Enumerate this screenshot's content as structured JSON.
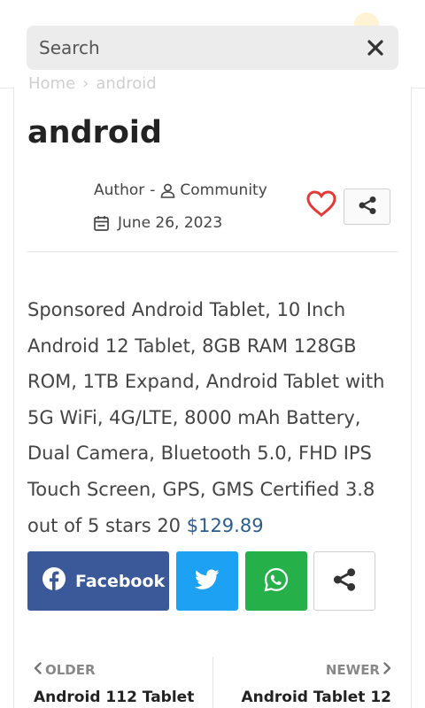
{
  "header": {
    "peek_title": ""
  },
  "search": {
    "placeholder": "Search",
    "value": ""
  },
  "breadcrumb": {
    "home": "Home",
    "separator": "›",
    "current": "android"
  },
  "post": {
    "title": "android",
    "author_label": "Author",
    "author_sep": "-",
    "author_name": "Community",
    "date": "June 26, 2023",
    "body_text": "Sponsored Android Tablet, 10 Inch Android 12 Tablet, 8GB RAM 128GB ROM, 1TB Expand, Android Tablet with 5G WiFi, 4G/LTE, 8000 mAh Battery, Dual Camera, Bluetooth 5.0, FHD IPS Touch Screen, GPS, GMS Certified 3.8 out of 5 stars 20 ",
    "price": "$129.89"
  },
  "share": {
    "facebook_label": "Facebook"
  },
  "post_nav": {
    "older_label": "OLDER",
    "older_title": "Android 112 Tablet",
    "newer_label": "NEWER",
    "newer_title": "Android Tablet 12"
  },
  "colors": {
    "facebook": "#3b5998",
    "twitter": "#1da1f2",
    "whatsapp": "#25b04a",
    "heart": "#e53935",
    "price": "#2a5d8f"
  },
  "icons": [
    "close-icon",
    "user-icon",
    "calendar-icon",
    "heart-icon",
    "share-icon",
    "facebook-icon",
    "twitter-icon",
    "whatsapp-icon",
    "chevron-left-icon",
    "chevron-right-icon"
  ]
}
